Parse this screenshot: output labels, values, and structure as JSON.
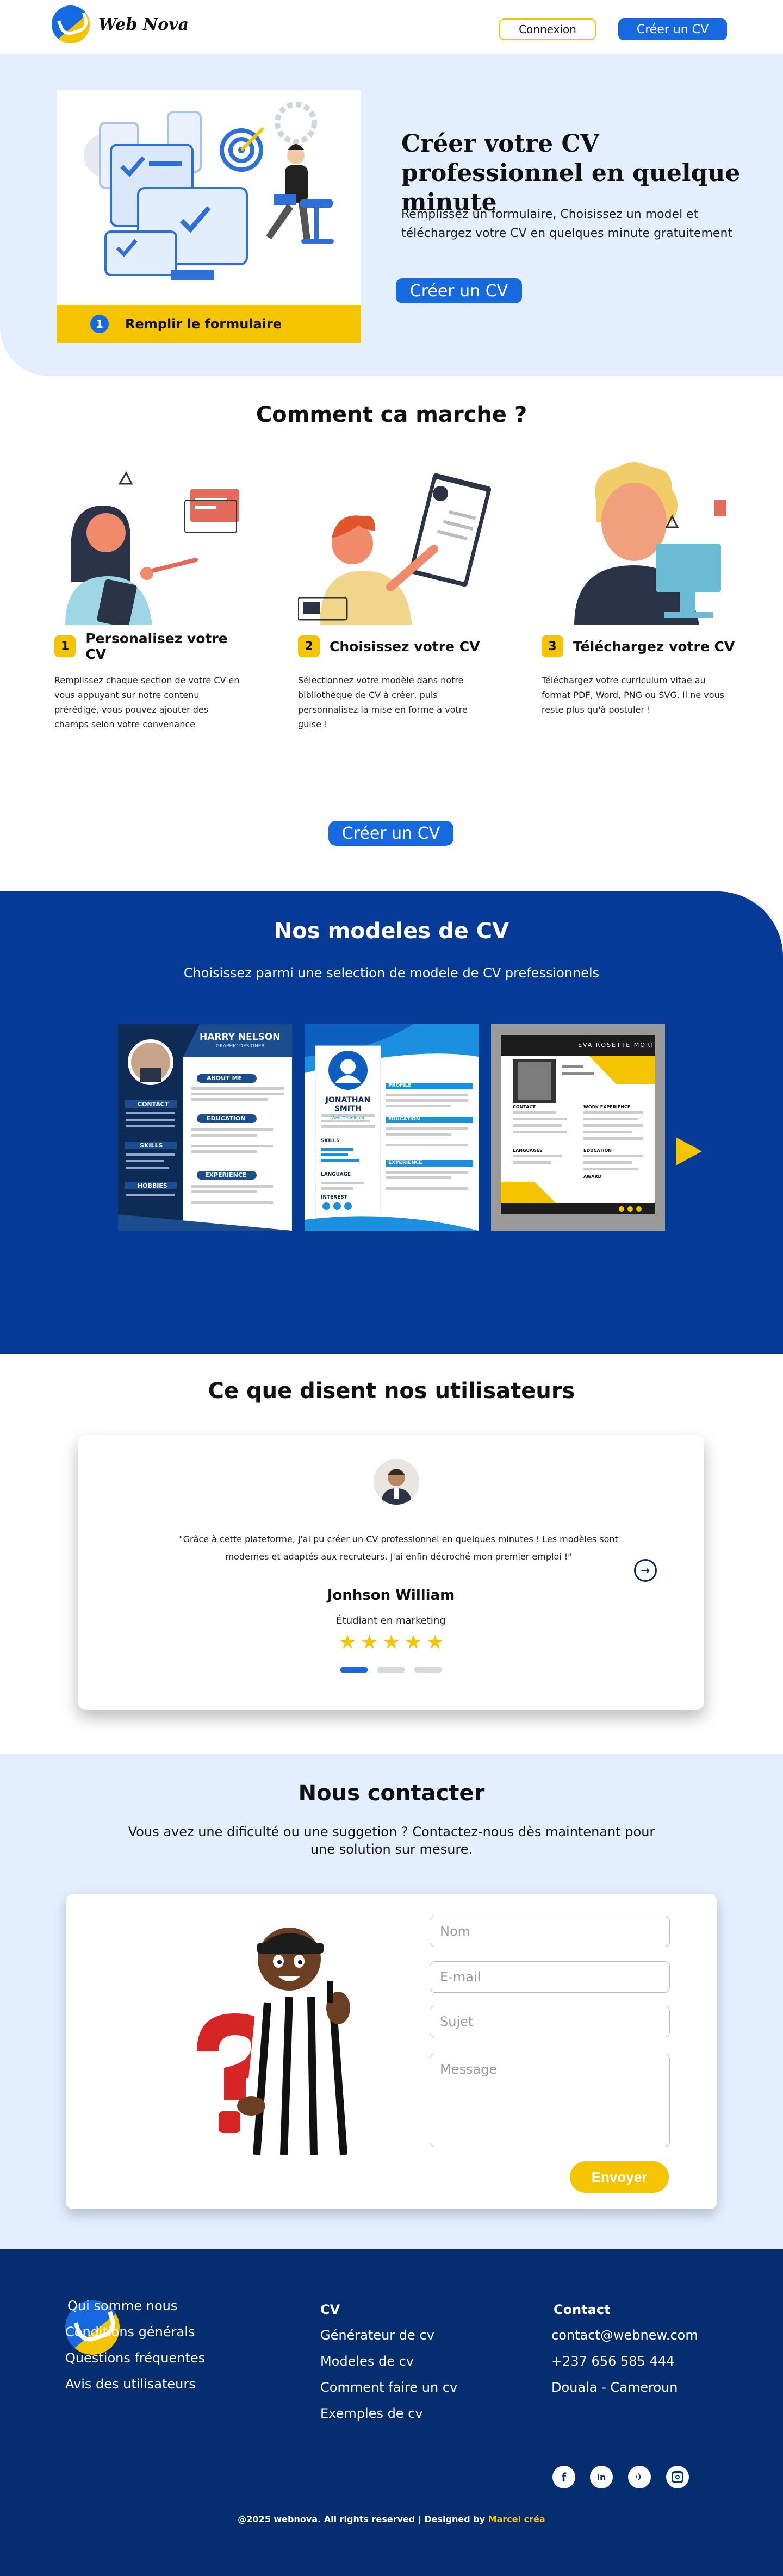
{
  "brand": {
    "name": "Web Nova"
  },
  "header": {
    "login_label": "Connexion",
    "create_label": "Créer un CV"
  },
  "hero": {
    "title": "Créer votre CV professionnel en quelque minute",
    "subtitle": "Remplissez un formulaire, Choisissez un model et téléchargez votre CV en quelques minute gratuitement",
    "cta_label": "Créer un CV",
    "card_step_number": "1",
    "card_step_label": "Remplir le formulaire"
  },
  "how": {
    "title": "Comment ca marche ?",
    "steps": [
      {
        "number": "1",
        "title": "Personalisez votre CV",
        "text": "Remplissez chaque section de votre CV en vous appuyant sur notre contenu prérédigé, vous pouvez ajouter des champs selon votre convenance"
      },
      {
        "number": "2",
        "title": "Choisissez votre CV",
        "text": "Sélectionnez votre modèle dans notre bibliothèque de CV à créer, puis personnalisez la mise en forme à votre guise !"
      },
      {
        "number": "3",
        "title": "Téléchargez votre CV",
        "text": "Téléchargez votre curriculum vitae au format PDF, Word, PNG ou SVG. Il ne vous reste plus qu'à postuler !"
      }
    ],
    "cta_label": "Créer un CV"
  },
  "models": {
    "title": "Nos modeles de CV",
    "subtitle": "Choisissez parmi une selection de modele de CV prefessionnels",
    "templates": [
      {
        "name": "HARRY NELSON",
        "role": "GRAPHIC DESIGNER",
        "sections": [
          "ABOUT ME",
          "EDUCATION",
          "CONTACT",
          "SKILLS",
          "EXPERIENCE",
          "HOBBIES"
        ]
      },
      {
        "name": "JONATHAN SMITH",
        "role": "Web Developer",
        "sections": [
          "PROFILE",
          "EDUCATION",
          "SKILLS",
          "LANGUAGE",
          "INTEREST",
          "EXPERIENCE"
        ]
      },
      {
        "name": "EVA ROSETTE MORI",
        "sections": [
          "CONTACT",
          "WORK EXPERIENCE",
          "LANGUAGES",
          "EDUCATION",
          "AWARD"
        ]
      }
    ]
  },
  "testimonials": {
    "title": "Ce que disent nos utilisateurs",
    "quote": "\"Grâce à cette plateforme, j'ai pu créer un CV professionnel en quelques minutes ! Les modèles sont modernes et adaptés aux recruteurs. J'ai enfin décroché mon premier emploi !\"",
    "name": "Jonhson William",
    "role": "Étudiant en marketing",
    "stars": 5,
    "slide_count": 3,
    "active_slide": 1
  },
  "contact": {
    "title": "Nous contacter",
    "subtitle": "Vous avez une dificulté ou une suggetion ? Contactez-nous dès maintenant pour une solution sur mesure.",
    "name_placeholder": "Nom",
    "email_placeholder": "E-mail",
    "subject_placeholder": "Sujet",
    "message_placeholder": "Message",
    "send_label": "Envoyer"
  },
  "footer": {
    "about_links": [
      "Qui somme nous",
      "Conditions générals",
      "Questions fréquentes",
      "Avis des utilisateurs"
    ],
    "cv_heading": "CV",
    "cv_links": [
      "Générateur de cv",
      "Modeles de cv",
      "Comment faire un cv",
      "Exemples de cv"
    ],
    "contact_heading": "Contact",
    "email": "contact@webnew.com",
    "phone": "+237 656 585 444",
    "address": "Douala - Cameroun",
    "socials": [
      "facebook-icon",
      "linkedin-icon",
      "twitter-icon",
      "instagram-icon"
    ],
    "copyright_main": "@2025 webnova. All rights reserved | Designed by ",
    "copyright_author": "Marcel créa"
  },
  "colors": {
    "primary": "#1769e0",
    "accent": "#f5c400",
    "navy": "#053b97",
    "footer": "#042e6f",
    "hero_bg": "#e3efff"
  }
}
